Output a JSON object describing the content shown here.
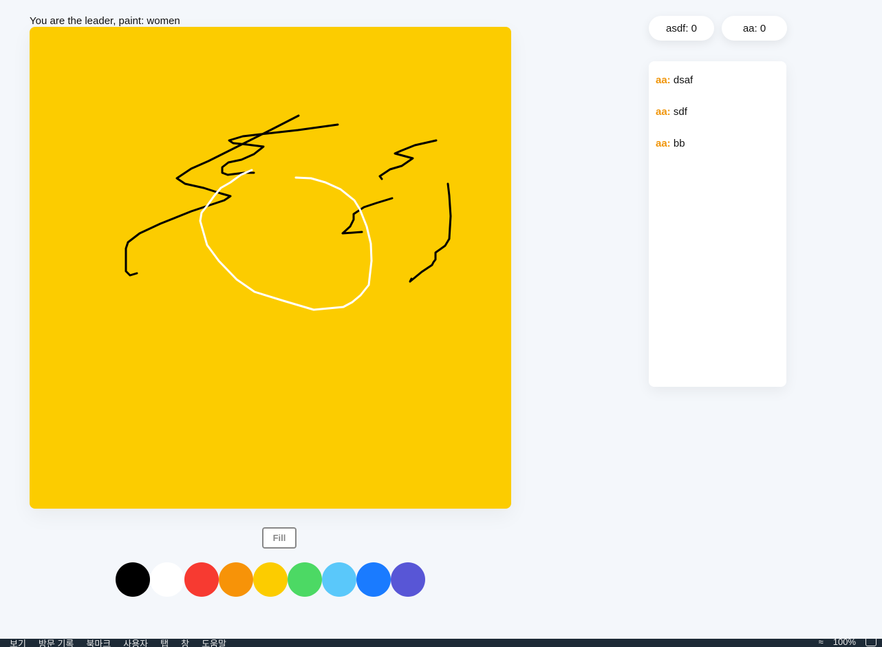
{
  "game": {
    "instruction": "You are the leader, paint: women"
  },
  "scores": [
    {
      "label": "asdf: 0"
    },
    {
      "label": "aa: 0"
    }
  ],
  "chat": {
    "messages": [
      {
        "user": "aa:",
        "text": "dsaf"
      },
      {
        "user": "aa:",
        "text": "sdf"
      },
      {
        "user": "aa:",
        "text": "bb"
      }
    ]
  },
  "controls": {
    "fill_label": "Fill"
  },
  "canvas": {
    "background_color": "#fccc00"
  },
  "palette": {
    "colors": [
      "#000000",
      "#ffffff",
      "#f73a31",
      "#f79308",
      "#fccc00",
      "#4cd964",
      "#5ac8fa",
      "#1a7bff",
      "#5856d6"
    ],
    "color_names": [
      "black",
      "white",
      "red",
      "orange",
      "yellow",
      "green",
      "light-blue",
      "blue",
      "purple"
    ]
  },
  "menubar": {
    "items": [
      "보기",
      "방문 기록",
      "북마크",
      "사용자",
      "탭",
      "창",
      "도움말"
    ],
    "status_battery": "100%"
  }
}
